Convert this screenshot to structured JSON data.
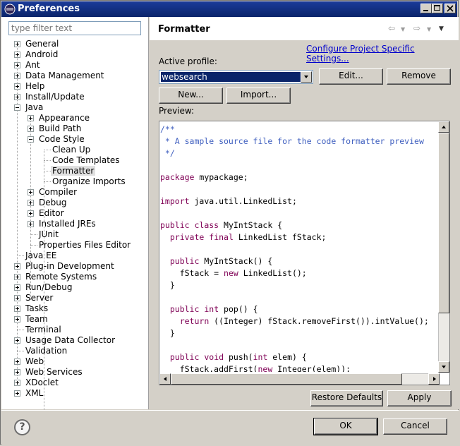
{
  "window": {
    "title": "Preferences"
  },
  "filter": {
    "placeholder": "type filter text"
  },
  "tree": [
    {
      "label": "General",
      "level": 0,
      "expander": "plus"
    },
    {
      "label": "Android",
      "level": 0,
      "expander": "plus"
    },
    {
      "label": "Ant",
      "level": 0,
      "expander": "plus"
    },
    {
      "label": "Data Management",
      "level": 0,
      "expander": "plus"
    },
    {
      "label": "Help",
      "level": 0,
      "expander": "plus"
    },
    {
      "label": "Install/Update",
      "level": 0,
      "expander": "plus"
    },
    {
      "label": "Java",
      "level": 0,
      "expander": "minus"
    },
    {
      "label": "Appearance",
      "level": 1,
      "expander": "plus"
    },
    {
      "label": "Build Path",
      "level": 1,
      "expander": "plus"
    },
    {
      "label": "Code Style",
      "level": 1,
      "expander": "minus"
    },
    {
      "label": "Clean Up",
      "level": 2,
      "expander": "none"
    },
    {
      "label": "Code Templates",
      "level": 2,
      "expander": "none"
    },
    {
      "label": "Formatter",
      "level": 2,
      "expander": "none",
      "selected": true
    },
    {
      "label": "Organize Imports",
      "level": 2,
      "expander": "none"
    },
    {
      "label": "Compiler",
      "level": 1,
      "expander": "plus"
    },
    {
      "label": "Debug",
      "level": 1,
      "expander": "plus"
    },
    {
      "label": "Editor",
      "level": 1,
      "expander": "plus"
    },
    {
      "label": "Installed JREs",
      "level": 1,
      "expander": "plus"
    },
    {
      "label": "JUnit",
      "level": 1,
      "expander": "none"
    },
    {
      "label": "Properties Files Editor",
      "level": 1,
      "expander": "none"
    },
    {
      "label": "Java EE",
      "level": 0,
      "expander": "none"
    },
    {
      "label": "Plug-in Development",
      "level": 0,
      "expander": "plus"
    },
    {
      "label": "Remote Systems",
      "level": 0,
      "expander": "plus"
    },
    {
      "label": "Run/Debug",
      "level": 0,
      "expander": "plus"
    },
    {
      "label": "Server",
      "level": 0,
      "expander": "plus"
    },
    {
      "label": "Tasks",
      "level": 0,
      "expander": "plus"
    },
    {
      "label": "Team",
      "level": 0,
      "expander": "plus"
    },
    {
      "label": "Terminal",
      "level": 0,
      "expander": "none"
    },
    {
      "label": "Usage Data Collector",
      "level": 0,
      "expander": "plus"
    },
    {
      "label": "Validation",
      "level": 0,
      "expander": "none"
    },
    {
      "label": "Web",
      "level": 0,
      "expander": "plus"
    },
    {
      "label": "Web Services",
      "level": 0,
      "expander": "plus"
    },
    {
      "label": "XDoclet",
      "level": 0,
      "expander": "plus"
    },
    {
      "label": "XML",
      "level": 0,
      "expander": "plus"
    }
  ],
  "page": {
    "title": "Formatter",
    "configure_link": "Configure Project Specific Settings...",
    "active_profile_label": "Active profile:",
    "profile_value": "websearch",
    "edit_button": "Edit...",
    "remove_button": "Remove",
    "new_button": "New...",
    "import_button": "Import...",
    "preview_label": "Preview:",
    "restore_defaults_button": "Restore Defaults",
    "apply_button": "Apply"
  },
  "preview_code": [
    [
      {
        "t": "/**",
        "c": "cm"
      }
    ],
    [
      {
        "t": " * A sample source file for the code formatter preview",
        "c": "cm"
      }
    ],
    [
      {
        "t": " */",
        "c": "cm"
      }
    ],
    [],
    [
      {
        "t": "package",
        "c": "kw"
      },
      {
        "t": " mypackage;",
        "c": ""
      }
    ],
    [],
    [
      {
        "t": "import",
        "c": "kw"
      },
      {
        "t": " java.util.LinkedList;",
        "c": ""
      }
    ],
    [],
    [
      {
        "t": "public",
        "c": "kw"
      },
      {
        "t": " ",
        "c": ""
      },
      {
        "t": "class",
        "c": "kw"
      },
      {
        "t": " MyIntStack {",
        "c": ""
      }
    ],
    [
      {
        "t": "  ",
        "c": ""
      },
      {
        "t": "private",
        "c": "kw"
      },
      {
        "t": " ",
        "c": ""
      },
      {
        "t": "final",
        "c": "kw"
      },
      {
        "t": " LinkedList fStack;",
        "c": ""
      }
    ],
    [],
    [
      {
        "t": "  ",
        "c": ""
      },
      {
        "t": "public",
        "c": "kw"
      },
      {
        "t": " MyIntStack() {",
        "c": ""
      }
    ],
    [
      {
        "t": "    fStack = ",
        "c": ""
      },
      {
        "t": "new",
        "c": "kw"
      },
      {
        "t": " LinkedList();",
        "c": ""
      }
    ],
    [
      {
        "t": "  }",
        "c": ""
      }
    ],
    [],
    [
      {
        "t": "  ",
        "c": ""
      },
      {
        "t": "public",
        "c": "kw"
      },
      {
        "t": " ",
        "c": ""
      },
      {
        "t": "int",
        "c": "kw"
      },
      {
        "t": " pop() {",
        "c": ""
      }
    ],
    [
      {
        "t": "    ",
        "c": ""
      },
      {
        "t": "return",
        "c": "kw"
      },
      {
        "t": " ((Integer) fStack.removeFirst()).intValue();",
        "c": ""
      }
    ],
    [
      {
        "t": "  }",
        "c": ""
      }
    ],
    [],
    [
      {
        "t": "  ",
        "c": ""
      },
      {
        "t": "public",
        "c": "kw"
      },
      {
        "t": " ",
        "c": ""
      },
      {
        "t": "void",
        "c": "kw"
      },
      {
        "t": " push(",
        "c": ""
      },
      {
        "t": "int",
        "c": "kw"
      },
      {
        "t": " elem) {",
        "c": ""
      }
    ],
    [
      {
        "t": "    fStack.addFirst(",
        "c": ""
      },
      {
        "t": "new",
        "c": "kw"
      },
      {
        "t": " Integer(elem));",
        "c": ""
      }
    ]
  ],
  "dialog": {
    "help_icon_glyph": "?",
    "ok_button": "OK",
    "cancel_button": "Cancel"
  }
}
